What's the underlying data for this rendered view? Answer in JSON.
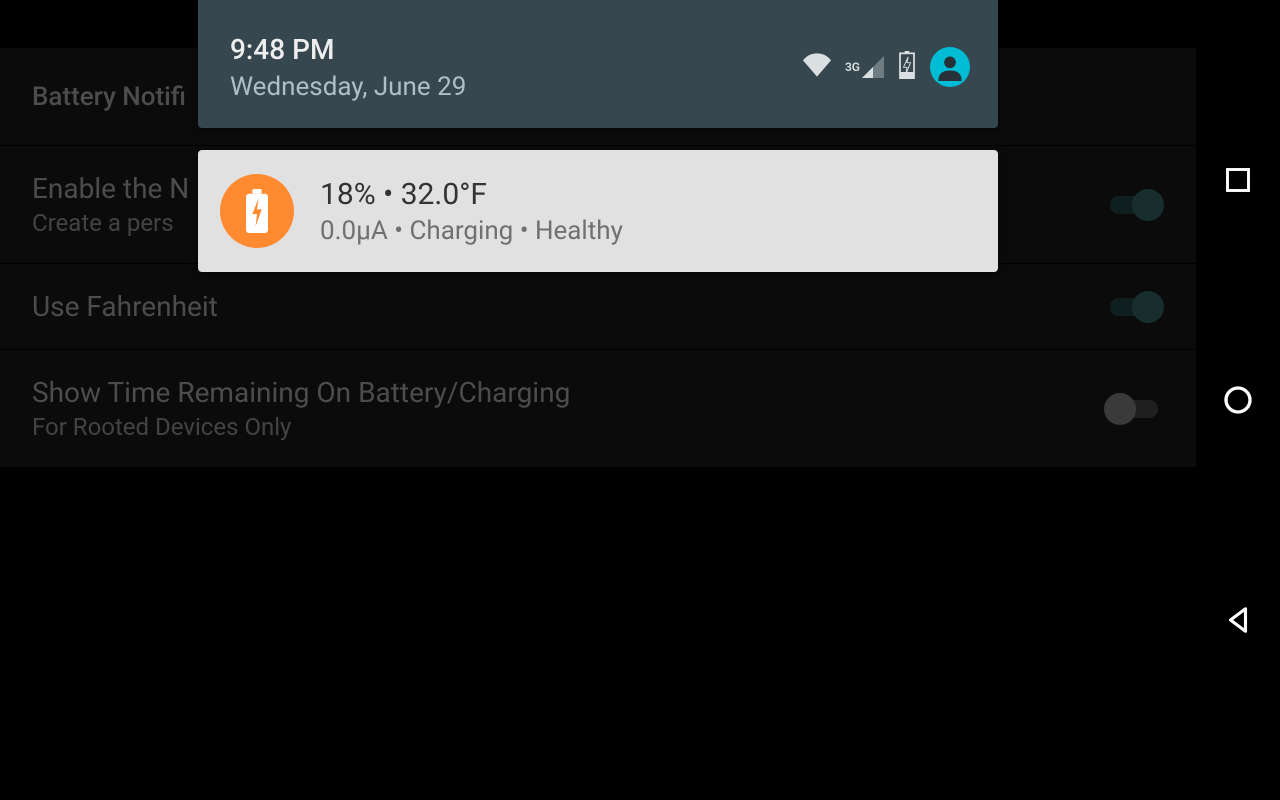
{
  "settings": {
    "header": "Battery Notifi",
    "rows": [
      {
        "title": "Enable the N",
        "subtitle": "Create a pers",
        "on": true
      },
      {
        "title": "Use Fahrenheit",
        "subtitle": "",
        "on": true
      },
      {
        "title": "Show Time Remaining On Battery/Charging",
        "subtitle": "For Rooted Devices Only",
        "on": false
      }
    ]
  },
  "shade": {
    "time": "9:48 PM",
    "date": "Wednesday, June 29",
    "signal_type": "3G"
  },
  "notification": {
    "title_line": "18% • 32.0°F",
    "sub_line": "0.0μA • Charging • Healthy"
  },
  "colors": {
    "shade_header": "#37474f",
    "card_bg": "#e1e1e1",
    "notif_icon": "#ff8a30",
    "avatar": "#00bcd4",
    "toggle_on": "#2d5555"
  }
}
